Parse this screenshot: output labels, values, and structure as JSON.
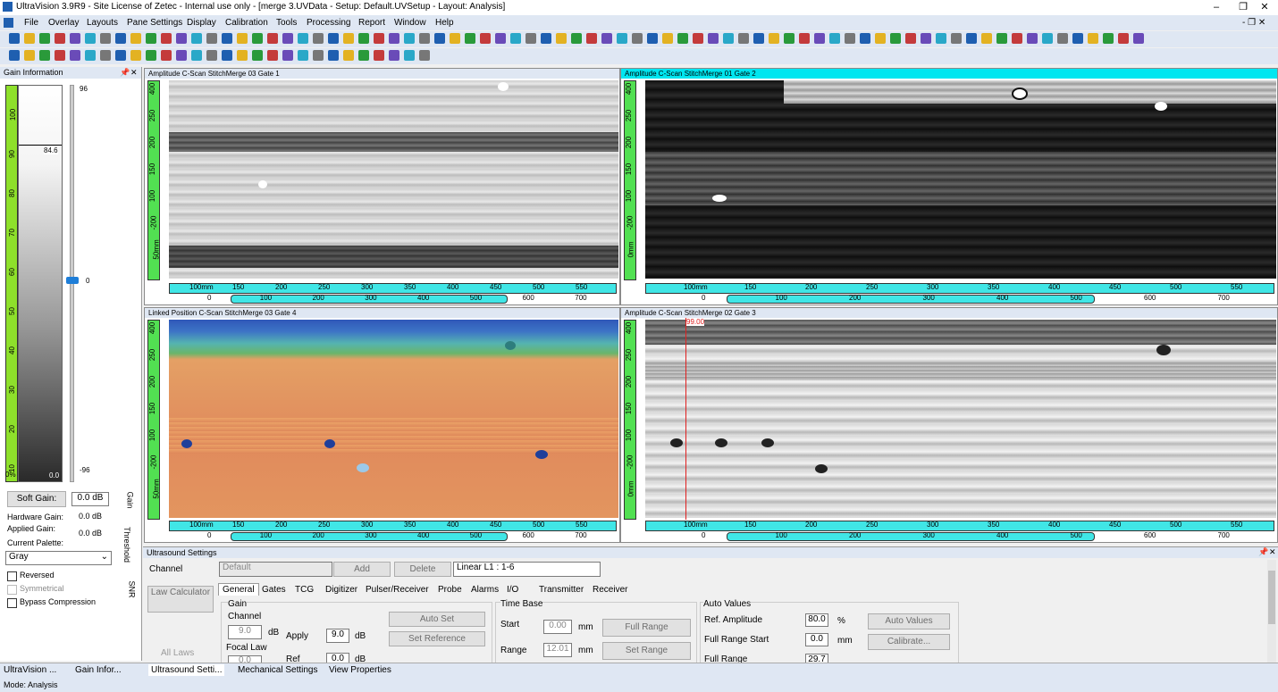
{
  "window": {
    "title": "UltraVision 3.9R9 - Site License of Zetec - Internal use only - [merge 3.UVData - Setup: Default.UVSetup - Layout: Analysis]",
    "minimize": "–",
    "restore": "❐",
    "close": "✕"
  },
  "menu": [
    "File",
    "Overlay",
    "Layouts",
    "Pane Settings",
    "Display",
    "Calibration",
    "Tools",
    "Processing",
    "Report",
    "Window",
    "Help"
  ],
  "gain_panel": {
    "title": "Gain Information",
    "scale_top": "96",
    "scale_bottom": "-96",
    "marker_value": "0",
    "bar_value": "84.6",
    "bar_bottom": "0.0",
    "bar_bottom_pct": "0%",
    "ruler_labels": [
      "100",
      "90",
      "80",
      "70",
      "60",
      "50",
      "40",
      "30",
      "20",
      "10",
      "0%"
    ],
    "soft_gain_button": "Soft Gain:",
    "soft_gain_value": "0.0 dB",
    "hardware_gain_label": "Hardware Gain:",
    "hardware_gain_value": "0.0 dB",
    "applied_gain_label": "Applied Gain:",
    "applied_gain_value": "0.0 dB",
    "palette_label": "Current Palette:",
    "palette_value": "Gray",
    "reversed": "Reversed",
    "symmetrical": "Symmetrical",
    "bypass": "Bypass Compression",
    "side_tabs": [
      "Gain",
      "Threshold",
      "SNR"
    ]
  },
  "panes": {
    "p1": {
      "title": "Amplitude C-Scan StitchMerge 03 Gate 1"
    },
    "p2": {
      "title": "Amplitude C-Scan StitchMerge 01 Gate 2"
    },
    "p3": {
      "title": "Linked Position C-Scan StitchMerge 03 Gate 4"
    },
    "p4": {
      "title": "Amplitude C-Scan StitchMerge 02 Gate 3",
      "cursor_label": "99.00"
    }
  },
  "rulers": {
    "vertical": [
      "400",
      "250",
      "200",
      "150",
      "100",
      "-200",
      "50mm"
    ],
    "vertical2": [
      "400",
      "250",
      "200",
      "150",
      "100",
      "-200",
      "0mm"
    ],
    "h_top": [
      "100mm",
      "150",
      "200",
      "250",
      "300",
      "350",
      "400",
      "450",
      "500",
      "550"
    ],
    "h_bottom": [
      "0",
      "100",
      "200",
      "300",
      "400",
      "500",
      "600",
      "700"
    ]
  },
  "ultrasound": {
    "title": "Ultrasound Settings",
    "channel_label": "Channel",
    "channel_value": "Default",
    "add": "Add",
    "delete": "Delete",
    "law": "Linear L1 : 1-6",
    "law_calc": "Law Calculator",
    "all_laws": "All Laws",
    "tabs": [
      "General",
      "Gates",
      "TCG",
      "Digitizer",
      "Pulser/Receiver",
      "Probe",
      "Alarms",
      "I/O",
      "Transmitter",
      "Receiver"
    ],
    "gain_group": "Gain",
    "channel_sub": "Channel",
    "channel_gain": "9.0",
    "db": "dB",
    "apply": "Apply",
    "apply_value": "9.0",
    "focal_law": "Focal Law",
    "focal_value": "0.0",
    "ref": "Ref",
    "ref_value": "0.0",
    "auto_set": "Auto Set",
    "set_reference": "Set Reference",
    "timebase_group": "Time Base",
    "start_label": "Start",
    "start_value": "0.00",
    "range_label": "Range",
    "range_value": "12.01",
    "mm": "mm",
    "full_range": "Full Range",
    "set_range": "Set Range",
    "auto_group": "Auto Values",
    "ref_amp_label": "Ref. Amplitude",
    "ref_amp_value": "80.0",
    "pct": "%",
    "full_start_label": "Full Range Start",
    "full_start_value": "0.0",
    "full_range_label": "Full Range",
    "full_range_value": "29.7",
    "auto_values": "Auto Values",
    "calibrate": "Calibrate..."
  },
  "taskbar": [
    "UltraVision ...",
    "Gain Infor...",
    "Ultrasound Setti...",
    "Mechanical Settings",
    "View Properties"
  ],
  "status": "Mode: Analysis"
}
